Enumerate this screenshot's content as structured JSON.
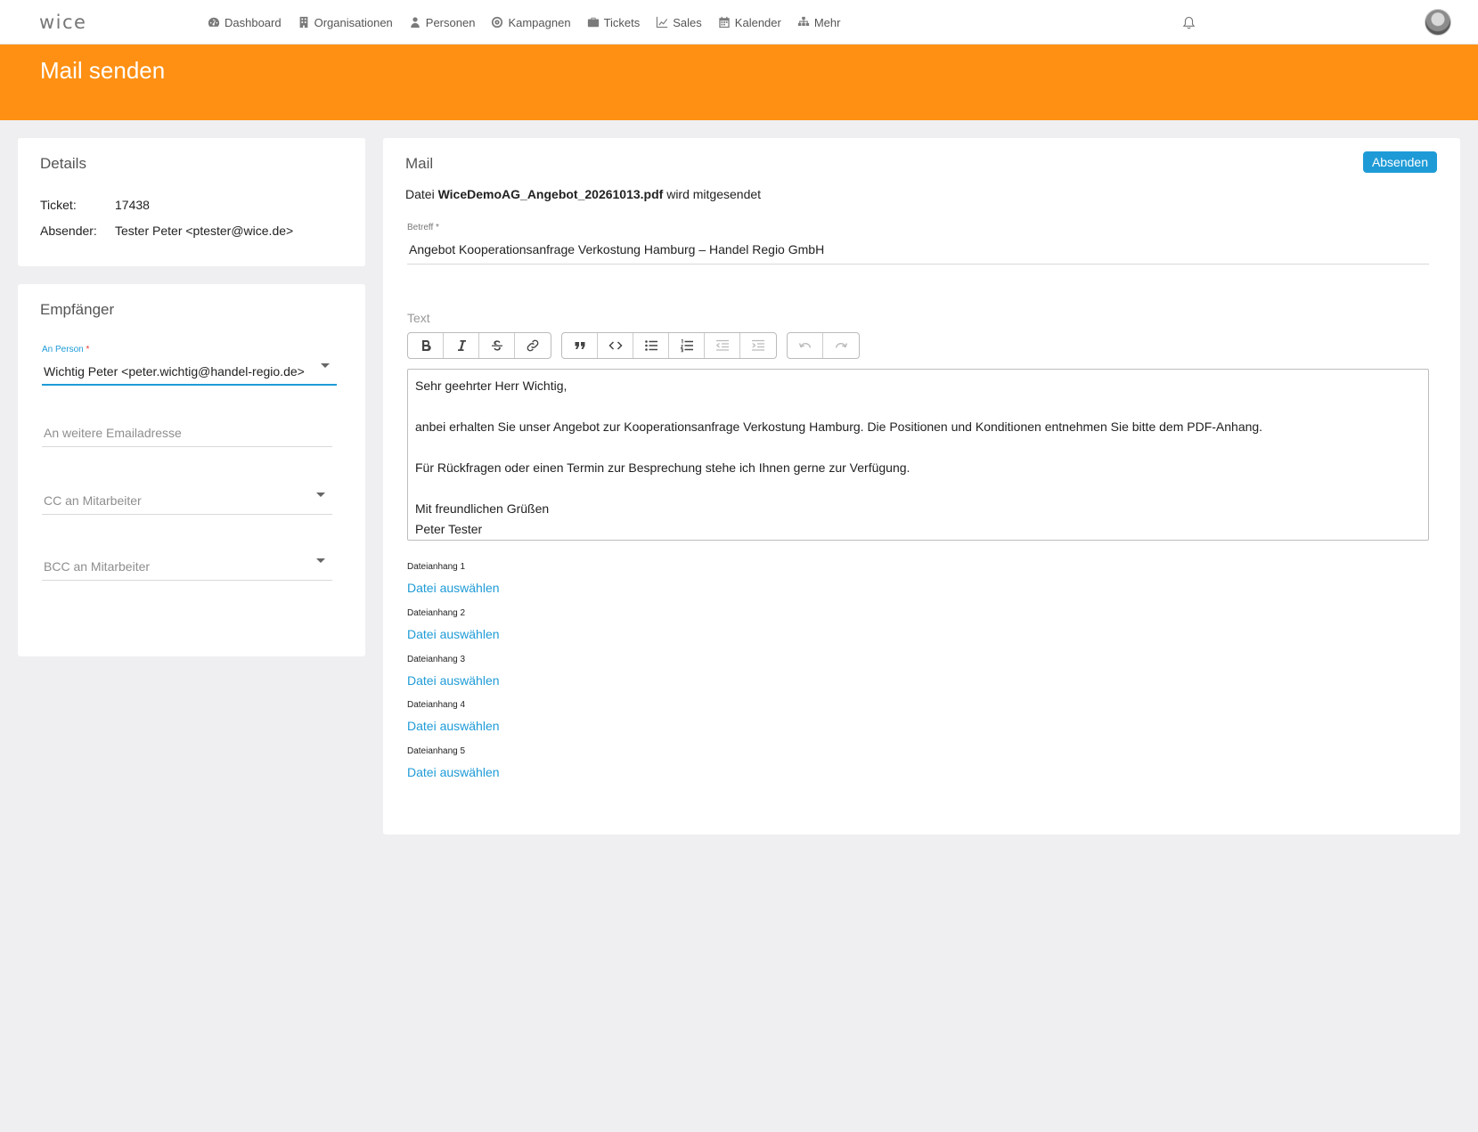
{
  "app": {
    "logo_text": "wice",
    "nav": [
      {
        "label": "Dashboard",
        "icon": "dashboard-gauge-icon"
      },
      {
        "label": "Organisationen",
        "icon": "building-icon"
      },
      {
        "label": "Personen",
        "icon": "person-icon"
      },
      {
        "label": "Kampagnen",
        "icon": "target-icon"
      },
      {
        "label": "Tickets",
        "icon": "briefcase-icon"
      },
      {
        "label": "Sales",
        "icon": "line-chart-icon"
      },
      {
        "label": "Kalender",
        "icon": "calendar-icon"
      },
      {
        "label": "Mehr",
        "icon": "sitemap-icon"
      }
    ],
    "notifications_icon": "bell-icon",
    "accent_color": "#ff9013",
    "link_color": "#1e9bd7"
  },
  "page": {
    "title": "Mail senden"
  },
  "details": {
    "title": "Details",
    "ticket_label": "Ticket:",
    "ticket_value": "17438",
    "sender_label": "Absender:",
    "sender_value": "Tester Peter <ptester@wice.de>"
  },
  "recipients": {
    "title": "Empfänger",
    "to_person_label": "An Person",
    "required_mark": "*",
    "to_person_value": "Wichtig Peter <peter.wichtig@handel-regio.de>",
    "more_email_placeholder": "An weitere Emailadresse",
    "cc_placeholder": "CC an Mitarbeiter",
    "bcc_placeholder": "BCC an Mitarbeiter"
  },
  "mail": {
    "title": "Mail",
    "send_button": "Absenden",
    "file_prefix": "Datei",
    "file_name": "WiceDemoAG_Angebot_20261013.pdf",
    "file_suffix": "wird mitgesendet",
    "subject_label": "Betreff *",
    "subject_value": "Angebot Kooperationsanfrage Verkostung Hamburg – Handel Regio GmbH",
    "text_label": "Text",
    "body": {
      "line1": "Sehr geehrter Herr Wichtig,",
      "line2": "",
      "line3": "anbei erhalten Sie unser Angebot zur Kooperationsanfrage Verkostung Hamburg. Die Positionen und Konditionen entnehmen Sie bitte dem PDF-Anhang.",
      "line4": "",
      "line5": "Für Rückfragen oder einen Termin zur Besprechung stehe ich Ihnen gerne zur Verfügung.",
      "line6": "",
      "line7": "Mit freundlichen Grüßen",
      "line8": "Peter Tester"
    },
    "toolbar": [
      {
        "icon": "bold-icon"
      },
      {
        "icon": "italic-icon"
      },
      {
        "icon": "strikethrough-icon"
      },
      {
        "icon": "link-icon"
      },
      {
        "icon": "blockquote-icon"
      },
      {
        "icon": "code-icon"
      },
      {
        "icon": "bullet-list-icon"
      },
      {
        "icon": "numbered-list-icon"
      },
      {
        "icon": "outdent-icon"
      },
      {
        "icon": "indent-icon"
      },
      {
        "icon": "undo-icon"
      },
      {
        "icon": "redo-icon"
      }
    ],
    "attachments": [
      {
        "label": "Dateianhang 1",
        "link": "Datei auswählen"
      },
      {
        "label": "Dateianhang 2",
        "link": "Datei auswählen"
      },
      {
        "label": "Dateianhang 3",
        "link": "Datei auswählen"
      },
      {
        "label": "Dateianhang 4",
        "link": "Datei auswählen"
      },
      {
        "label": "Dateianhang 5",
        "link": "Datei auswählen"
      }
    ]
  }
}
